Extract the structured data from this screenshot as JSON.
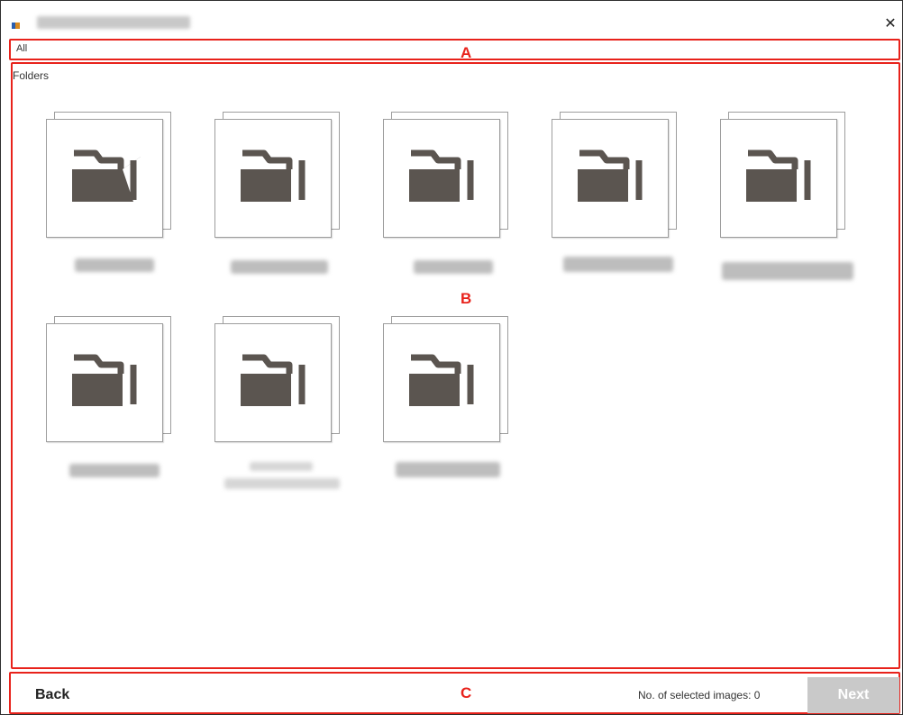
{
  "window": {
    "title_blurred": true
  },
  "breadcrumb": {
    "current": "All"
  },
  "region_labels": {
    "a": "A",
    "b": "B",
    "c": "C"
  },
  "main": {
    "heading": "Folders",
    "folders": [
      {
        "label_blurred": true
      },
      {
        "label_blurred": true
      },
      {
        "label_blurred": true
      },
      {
        "label_blurred": true
      },
      {
        "label_blurred": true
      },
      {
        "label_blurred": true
      },
      {
        "label_blurred": true
      },
      {
        "label_blurred": true
      }
    ],
    "folder_icon": "folder-open-icon"
  },
  "footer": {
    "back_label": "Back",
    "selected_count_label": "No. of selected images: 0",
    "next_label": "Next"
  },
  "colors": {
    "annotation_red": "#e8221b",
    "folder_icon": "#5b5550",
    "next_disabled_bg": "#c9c9c9"
  }
}
